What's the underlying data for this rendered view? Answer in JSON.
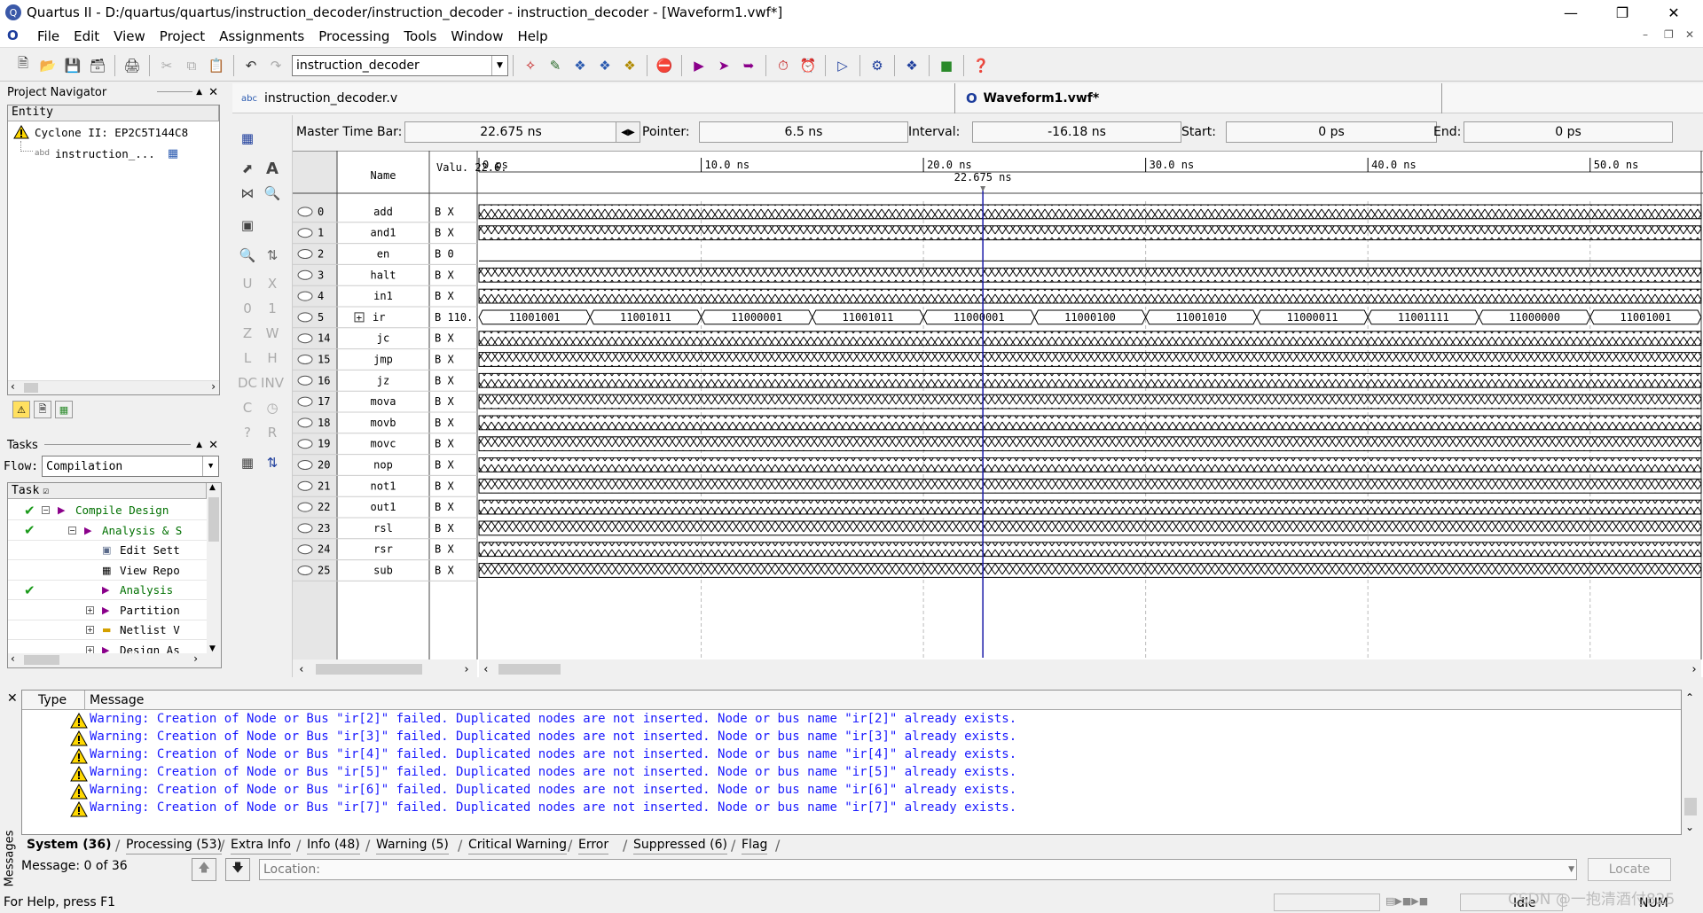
{
  "window": {
    "title": "Quartus II - D:/quartus/quartus/instruction_decoder/instruction_decoder - instruction_decoder - [Waveform1.vwf*]"
  },
  "menu": [
    "File",
    "Edit",
    "View",
    "Project",
    "Assignments",
    "Processing",
    "Tools",
    "Window",
    "Help"
  ],
  "toolbar": {
    "entity_combo": "instruction_decoder"
  },
  "project_navigator": {
    "title": "Project Navigator",
    "header": "Entity",
    "device": "Cyclone II: EP2C5T144C8",
    "top_entity": "instruction_..."
  },
  "tasks": {
    "title": "Tasks",
    "flow_label": "Flow:",
    "flow_value": "Compilation",
    "header": "Task",
    "items": [
      {
        "label": "Compile Design",
        "checked": true,
        "color": "#007000"
      },
      {
        "label": "Analysis & S",
        "checked": true,
        "color": "#007000"
      },
      {
        "label": "Edit Sett",
        "checked": false,
        "color": "#000000"
      },
      {
        "label": "View Repo",
        "checked": false,
        "color": "#000000"
      },
      {
        "label": "Analysis",
        "checked": true,
        "color": "#007000"
      },
      {
        "label": "Partition",
        "checked": false,
        "color": "#000000"
      },
      {
        "label": "Netlist V",
        "checked": false,
        "color": "#000000"
      },
      {
        "label": "Design As",
        "checked": false,
        "color": "#000000"
      }
    ]
  },
  "doc_tabs": [
    {
      "label": "instruction_decoder.v",
      "active": false
    },
    {
      "label": "Waveform1.vwf*",
      "active": true
    }
  ],
  "timebar": {
    "master_label": "Master Time Bar:",
    "master_value": "22.675 ns",
    "pointer_label": "Pointer:",
    "pointer_value": "6.5 ns",
    "interval_label": "Interval:",
    "interval_value": "-16.18 ns",
    "start_label": "Start:",
    "start_value": "0 ps",
    "end_label": "End:",
    "end_value": "0 ps"
  },
  "waveform": {
    "name_header": "Name",
    "value_header": "Valu. 22.6.",
    "cursor_label": "22.675 ns",
    "cursor_ns": 22.675,
    "time_range_ns": [
      0,
      55
    ],
    "ticks": [
      {
        "ns": 0,
        "label": "0 ps"
      },
      {
        "ns": 10,
        "label": "10.0 ns"
      },
      {
        "ns": 20,
        "label": "20.0 ns"
      },
      {
        "ns": 30,
        "label": "30.0 ns"
      },
      {
        "ns": 40,
        "label": "40.0 ns"
      },
      {
        "ns": 50,
        "label": "50.0 ns"
      }
    ],
    "signals": [
      {
        "idx": "0",
        "name": "add",
        "value": "B X",
        "kind": "x"
      },
      {
        "idx": "1",
        "name": "and1",
        "value": "B X",
        "kind": "x"
      },
      {
        "idx": "2",
        "name": "en",
        "value": "B 0",
        "kind": "low"
      },
      {
        "idx": "3",
        "name": "halt",
        "value": "B X",
        "kind": "x"
      },
      {
        "idx": "4",
        "name": "in1",
        "value": "B X",
        "kind": "x"
      },
      {
        "idx": "5",
        "name": "ir",
        "value": "B 110.",
        "kind": "bus",
        "expand": "+"
      },
      {
        "idx": "14",
        "name": "jc",
        "value": "B X",
        "kind": "x"
      },
      {
        "idx": "15",
        "name": "jmp",
        "value": "B X",
        "kind": "x"
      },
      {
        "idx": "16",
        "name": "jz",
        "value": "B X",
        "kind": "x"
      },
      {
        "idx": "17",
        "name": "mova",
        "value": "B X",
        "kind": "x"
      },
      {
        "idx": "18",
        "name": "movb",
        "value": "B X",
        "kind": "x"
      },
      {
        "idx": "19",
        "name": "movc",
        "value": "B X",
        "kind": "x"
      },
      {
        "idx": "20",
        "name": "nop",
        "value": "B X",
        "kind": "x"
      },
      {
        "idx": "21",
        "name": "not1",
        "value": "B X",
        "kind": "x"
      },
      {
        "idx": "22",
        "name": "out1",
        "value": "B X",
        "kind": "x"
      },
      {
        "idx": "23",
        "name": "rsl",
        "value": "B X",
        "kind": "x"
      },
      {
        "idx": "24",
        "name": "rsr",
        "value": "B X",
        "kind": "x"
      },
      {
        "idx": "25",
        "name": "sub",
        "value": "B X",
        "kind": "x"
      }
    ],
    "bus_segments": [
      "11001001",
      "11001011",
      "11000001",
      "11001011",
      "11000001",
      "11000100",
      "11001010",
      "11000011",
      "11001111",
      "11000000",
      "11001001"
    ],
    "bus_period_ns": 5
  },
  "messages": {
    "col_type": "Type",
    "col_message": "Message",
    "lines": [
      "Warning: Creation of Node or Bus \"ir[2]\" failed. Duplicated nodes are not inserted. Node or bus name \"ir[2]\" already exists.",
      "Warning: Creation of Node or Bus \"ir[3]\" failed. Duplicated nodes are not inserted. Node or bus name \"ir[3]\" already exists.",
      "Warning: Creation of Node or Bus \"ir[4]\" failed. Duplicated nodes are not inserted. Node or bus name \"ir[4]\" already exists.",
      "Warning: Creation of Node or Bus \"ir[5]\" failed. Duplicated nodes are not inserted. Node or bus name \"ir[5]\" already exists.",
      "Warning: Creation of Node or Bus \"ir[6]\" failed. Duplicated nodes are not inserted. Node or bus name \"ir[6]\" already exists.",
      "Warning: Creation of Node or Bus \"ir[7]\" failed. Duplicated nodes are not inserted. Node or bus name \"ir[7]\" already exists."
    ],
    "tabs": [
      "System (36)",
      "Processing (53)",
      "Extra Info",
      "Info (48)",
      "Warning (5)",
      "Critical Warning",
      "Error",
      "Suppressed (6)",
      "Flag"
    ],
    "side_label": "Messages",
    "count": "Message: 0 of 36",
    "location_label": "Location:",
    "locate_button": "Locate"
  },
  "status": {
    "help": "For Help, press F1",
    "idle": "Idle",
    "num": "NUM",
    "watermark": "CSDN @一抱清酒付825"
  },
  "colors": {
    "accent": "#1d3d9c",
    "warning_text": "#1a1aff",
    "cursor": "#1c1ca8",
    "ok_green": "#007000"
  }
}
